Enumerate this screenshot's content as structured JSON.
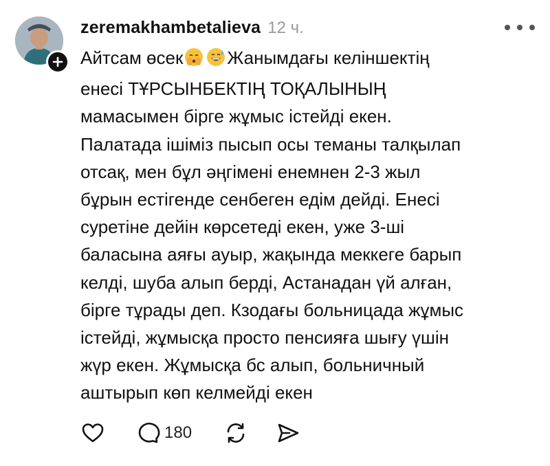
{
  "post": {
    "username": "zeremakhambetalieva",
    "time": "12 ч.",
    "lines": [
      {
        "before": "Айтсам өсек",
        "after": "Жанымдағы келіншектің"
      },
      {
        "text": "енесі ТҰРСЫНБЕКТІҢ ТОҚАЛЫНЫҢ"
      },
      {
        "text": "мамасымен бірге жұмыс істейді екен."
      },
      {
        "text": "Палатада ішіміз пысып осы теманы талқылап"
      },
      {
        "text": "отсақ, мен бұл әңгімені енемнен 2-3 жыл"
      },
      {
        "text": "бұрын естігенде сенбеген едім дейді. Енесі"
      },
      {
        "text": "суретіне дейін көрсетеді екен, уже 3-ші"
      },
      {
        "text": "баласына аяғы ауыр, жақында меккеге барып"
      },
      {
        "text": "келді, шуба алып берді, Астанадан үй алған,"
      },
      {
        "text": "бірге тұрады деп. Кзодағы больницада жұмыс"
      },
      {
        "text": "істейді, жұмысқа просто пенсияға шығу үшін"
      },
      {
        "text": "жүр екен. Жұмысқа бс алып, больничный"
      },
      {
        "text": "аштырып көп келмейді екен"
      }
    ],
    "emojis": [
      "peeking-face-emoji",
      "grinning-sweat-emoji"
    ],
    "reply_count": "180"
  },
  "icons": [
    "avatar",
    "plus-icon",
    "more-icon",
    "heart-icon",
    "comment-icon",
    "repost-icon",
    "share-icon"
  ]
}
